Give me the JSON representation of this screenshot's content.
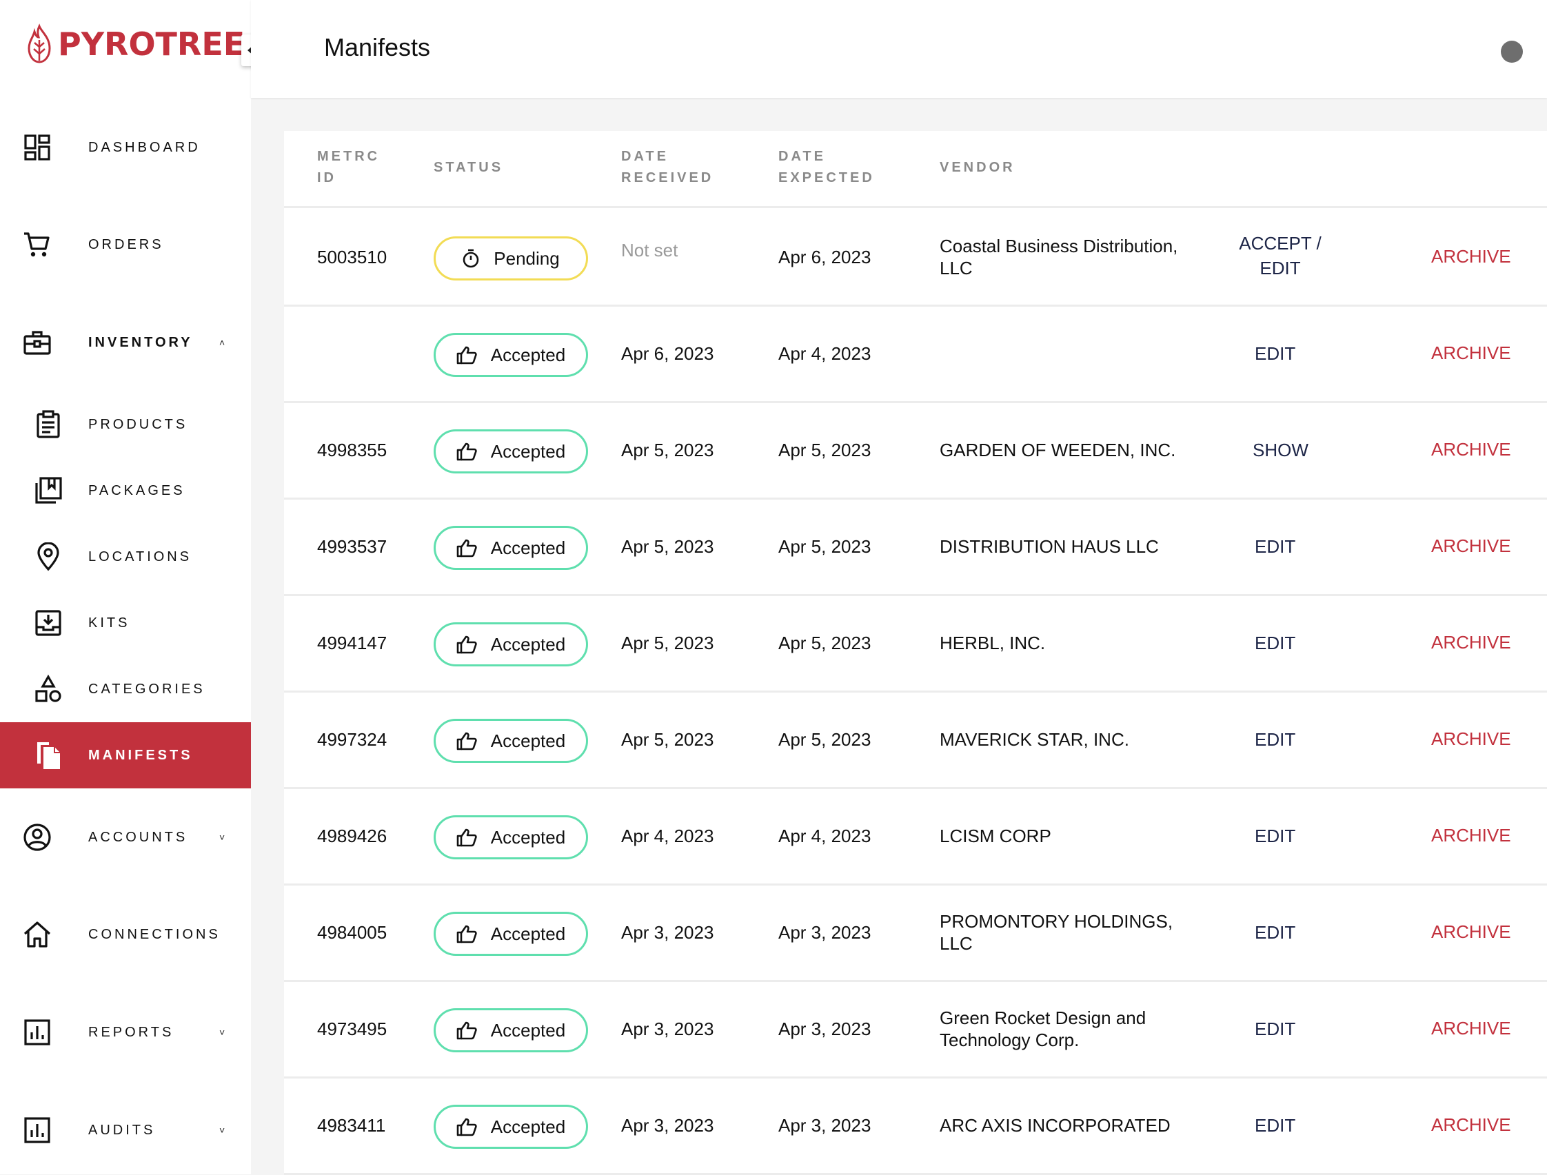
{
  "app": {
    "name": "PYROTREE",
    "brand_color": "#c2313d"
  },
  "header": {
    "title": "Manifests"
  },
  "sidebar": {
    "items": [
      {
        "key": "dashboard",
        "label": "DASHBOARD",
        "icon": "dashboard-icon"
      },
      {
        "key": "orders",
        "label": "ORDERS",
        "icon": "cart-icon"
      },
      {
        "key": "inventory",
        "label": "INVENTORY",
        "icon": "toolbox-icon",
        "expanded": true
      },
      {
        "key": "products",
        "label": "PRODUCTS",
        "icon": "clipboard-icon"
      },
      {
        "key": "packages",
        "label": "PACKAGES",
        "icon": "bookmark-stack-icon"
      },
      {
        "key": "locations",
        "label": "LOCATIONS",
        "icon": "map-pin-icon"
      },
      {
        "key": "kits",
        "label": "KITS",
        "icon": "tray-download-icon"
      },
      {
        "key": "categories",
        "label": "CATEGORIES",
        "icon": "shapes-icon"
      },
      {
        "key": "manifests",
        "label": "MANIFESTS",
        "icon": "documents-icon",
        "active": true
      },
      {
        "key": "accounts",
        "label": "ACCOUNTS",
        "icon": "user-circle-icon",
        "expanded": false
      },
      {
        "key": "connections",
        "label": "CONNECTIONS",
        "icon": "home-icon"
      },
      {
        "key": "reports",
        "label": "REPORTS",
        "icon": "bar-chart-icon",
        "expanded": false
      },
      {
        "key": "audits",
        "label": "AUDITS",
        "icon": "bar-chart-icon",
        "expanded": false
      }
    ]
  },
  "table": {
    "headers": {
      "metrc_id": [
        "METRC",
        "ID"
      ],
      "status": [
        "STATUS"
      ],
      "date_received": [
        "DATE",
        "RECEIVED"
      ],
      "date_expected": [
        "DATE",
        "EXPECTED"
      ],
      "vendor": [
        "VENDOR"
      ]
    },
    "rows": [
      {
        "metrc_id": "5003510",
        "status": "Pending",
        "date_received": "Not set",
        "date_expected": "Apr 6, 2023",
        "vendor": [
          "Coastal Business Distribution,",
          "LLC"
        ],
        "action": [
          "ACCEPT /",
          "EDIT"
        ],
        "archive": "ARCHIVE"
      },
      {
        "metrc_id": "",
        "status": "Accepted",
        "date_received": "Apr 6, 2023",
        "date_expected": "Apr 4, 2023",
        "vendor": [
          ""
        ],
        "action": [
          "EDIT"
        ],
        "archive": "ARCHIVE"
      },
      {
        "metrc_id": "4998355",
        "status": "Accepted",
        "date_received": "Apr 5, 2023",
        "date_expected": "Apr 5, 2023",
        "vendor": [
          "GARDEN OF WEEDEN, INC."
        ],
        "action": [
          "SHOW"
        ],
        "archive": "ARCHIVE"
      },
      {
        "metrc_id": "4993537",
        "status": "Accepted",
        "date_received": "Apr 5, 2023",
        "date_expected": "Apr 5, 2023",
        "vendor": [
          "DISTRIBUTION HAUS LLC"
        ],
        "action": [
          "EDIT"
        ],
        "archive": "ARCHIVE"
      },
      {
        "metrc_id": "4994147",
        "status": "Accepted",
        "date_received": "Apr 5, 2023",
        "date_expected": "Apr 5, 2023",
        "vendor": [
          "HERBL, INC."
        ],
        "action": [
          "EDIT"
        ],
        "archive": "ARCHIVE"
      },
      {
        "metrc_id": "4997324",
        "status": "Accepted",
        "date_received": "Apr 5, 2023",
        "date_expected": "Apr 5, 2023",
        "vendor": [
          "MAVERICK STAR, INC."
        ],
        "action": [
          "EDIT"
        ],
        "archive": "ARCHIVE"
      },
      {
        "metrc_id": "4989426",
        "status": "Accepted",
        "date_received": "Apr 4, 2023",
        "date_expected": "Apr 4, 2023",
        "vendor": [
          "LCISM CORP"
        ],
        "action": [
          "EDIT"
        ],
        "archive": "ARCHIVE"
      },
      {
        "metrc_id": "4984005",
        "status": "Accepted",
        "date_received": "Apr 3, 2023",
        "date_expected": "Apr 3, 2023",
        "vendor": [
          "PROMONTORY HOLDINGS,",
          "LLC"
        ],
        "action": [
          "EDIT"
        ],
        "archive": "ARCHIVE"
      },
      {
        "metrc_id": "4973495",
        "status": "Accepted",
        "date_received": "Apr 3, 2023",
        "date_expected": "Apr 3, 2023",
        "vendor": [
          "Green Rocket Design and",
          "Technology Corp."
        ],
        "action": [
          "EDIT"
        ],
        "archive": "ARCHIVE"
      },
      {
        "metrc_id": "4983411",
        "status": "Accepted",
        "date_received": "Apr 3, 2023",
        "date_expected": "Apr 3, 2023",
        "vendor": [
          "ARC AXIS INCORPORATED"
        ],
        "action": [
          "EDIT"
        ],
        "archive": "ARCHIVE"
      }
    ]
  }
}
